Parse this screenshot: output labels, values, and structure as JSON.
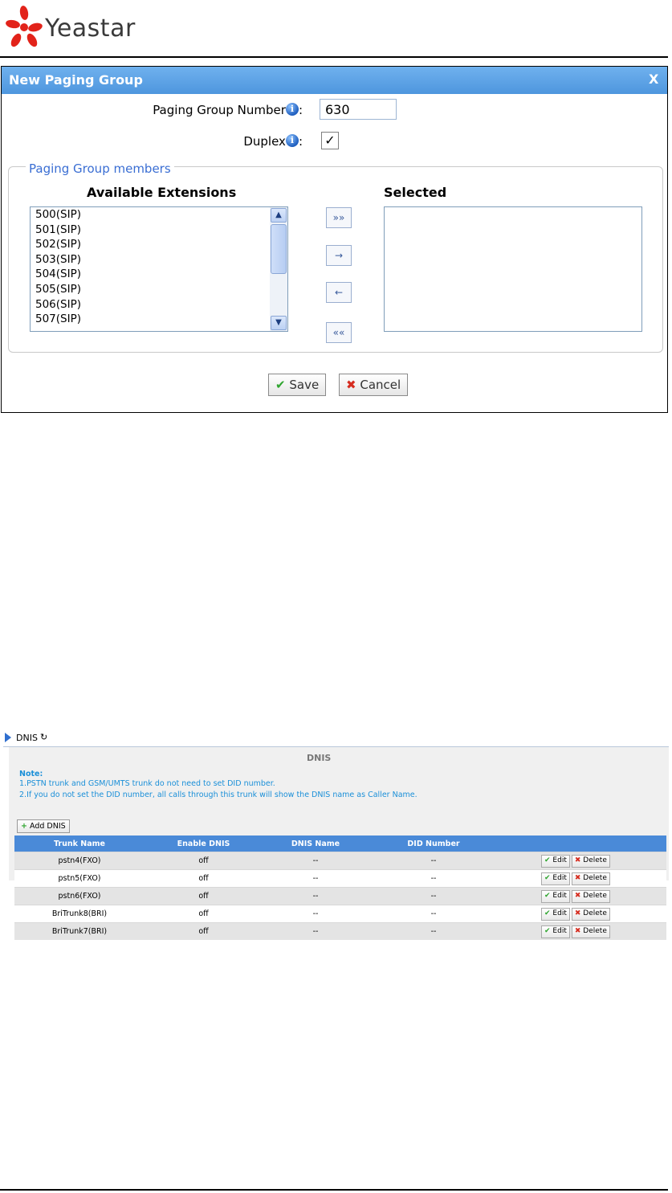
{
  "header": {
    "logo_text": "Yeastar"
  },
  "paging_dialog": {
    "title": "New Paging Group",
    "close_label": "X",
    "number_label": "Paging Group Number",
    "number_value": "630",
    "duplex_label": "Duplex",
    "colon": ":",
    "duplex_checked": true,
    "members_legend": "Paging Group members",
    "available_heading": "Available Extensions",
    "selected_heading": "Selected",
    "available_extensions": [
      "500(SIP)",
      "501(SIP)",
      "502(SIP)",
      "503(SIP)",
      "504(SIP)",
      "505(SIP)",
      "506(SIP)",
      "507(SIP)"
    ],
    "move_buttons": {
      "add_all": "»»",
      "add": "→",
      "remove": "←",
      "remove_all": "««"
    },
    "save_label": "Save",
    "cancel_label": "Cancel"
  },
  "dnis": {
    "bar_label": "DNIS",
    "title": "DNIS",
    "note_heading": "Note:",
    "note_1": "1.PSTN trunk and GSM/UMTS trunk do not need to set DID number.",
    "note_2": "2.If you do not set the DID number, all calls through this trunk will show the DNIS name as Caller Name.",
    "add_label": "Add DNIS",
    "columns": [
      "Trunk Name",
      "Enable DNIS",
      "DNIS Name",
      "DID Number",
      ""
    ],
    "rows": [
      {
        "trunk": "pstn4(FXO)",
        "enable": "off",
        "name": "--",
        "did": "--"
      },
      {
        "trunk": "pstn5(FXO)",
        "enable": "off",
        "name": "--",
        "did": "--"
      },
      {
        "trunk": "pstn6(FXO)",
        "enable": "off",
        "name": "--",
        "did": "--"
      },
      {
        "trunk": "BriTrunk8(BRI)",
        "enable": "off",
        "name": "--",
        "did": "--"
      },
      {
        "trunk": "BriTrunk7(BRI)",
        "enable": "off",
        "name": "--",
        "did": "--"
      }
    ],
    "edit_label": "Edit",
    "delete_label": "Delete"
  }
}
